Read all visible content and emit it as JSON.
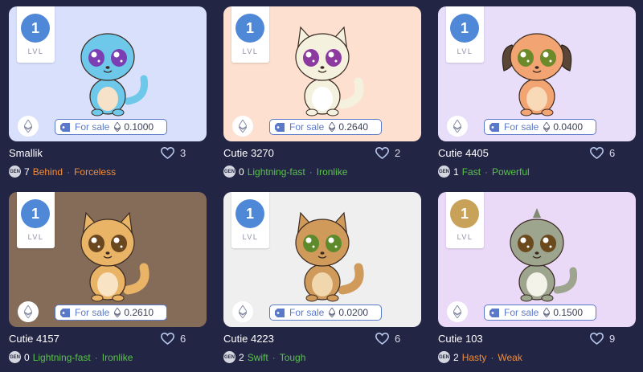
{
  "cards": [
    {
      "name": "Smallik",
      "level": "1",
      "level_label": "LVL",
      "level_color": "#4f88d6",
      "bg": "#d8e0fb",
      "sale_label": "For sale",
      "price": "0.1000",
      "likes": "3",
      "generation": "7",
      "gen_icon": "GEN",
      "trait1": "Behind",
      "trait1_color": "#ef8d3a",
      "trait2": "Forceless",
      "trait2_color": "#ef8d3a",
      "body_color": "#6ec8ea",
      "belly_color": "#f5e2c8",
      "eye_color": "#7b3fb3",
      "species": "lizard"
    },
    {
      "name": "Cutie 3270",
      "level": "1",
      "level_label": "LVL",
      "level_color": "#4f88d6",
      "bg": "#fde0cf",
      "sale_label": "For sale",
      "price": "0.2640",
      "likes": "2",
      "generation": "0",
      "gen_icon": "GEN",
      "trait1": "Lightning-fast",
      "trait1_color": "#59c24a",
      "trait2": "Ironlike",
      "trait2_color": "#59c24a",
      "body_color": "#f4f1de",
      "belly_color": "#ffffff",
      "eye_color": "#8c3aa0",
      "species": "cat"
    },
    {
      "name": "Cutie 4405",
      "level": "1",
      "level_label": "LVL",
      "level_color": "#4f88d6",
      "bg": "#e8def9",
      "sale_label": "For sale",
      "price": "0.0400",
      "likes": "6",
      "generation": "1",
      "gen_icon": "GEN",
      "trait1": "Fast",
      "trait1_color": "#59c24a",
      "trait2": "Powerful",
      "trait2_color": "#59c24a",
      "body_color": "#f2a472",
      "belly_color": "#f8d9b8",
      "eye_color": "#6c8a2a",
      "species": "dog"
    },
    {
      "name": "Cutie 4157",
      "level": "1",
      "level_label": "LVL",
      "level_color": "#4f88d6",
      "bg": "#856c59",
      "sale_label": "For sale",
      "price": "0.2610",
      "likes": "6",
      "generation": "0",
      "gen_icon": "GEN",
      "trait1": "Lightning-fast",
      "trait1_color": "#59c24a",
      "trait2": "Ironlike",
      "trait2_color": "#59c24a",
      "body_color": "#e9b465",
      "belly_color": "#f8e4c4",
      "eye_color": "#6b4720",
      "species": "lynx"
    },
    {
      "name": "Cutie 4223",
      "level": "1",
      "level_label": "LVL",
      "level_color": "#4f88d6",
      "bg": "#efefef",
      "sale_label": "For sale",
      "price": "0.0200",
      "likes": "6",
      "generation": "2",
      "gen_icon": "GEN",
      "trait1": "Swift",
      "trait1_color": "#59c24a",
      "trait2": "Tough",
      "trait2_color": "#59c24a",
      "body_color": "#cf9a5a",
      "belly_color": "#f0d7ae",
      "eye_color": "#5d8a2a",
      "species": "fox"
    },
    {
      "name": "Cutie 103",
      "level": "1",
      "level_label": "LVL",
      "level_color": "#c9a25a",
      "bg": "#ead9f7",
      "sale_label": "For sale",
      "price": "0.1500",
      "likes": "9",
      "generation": "2",
      "gen_icon": "GEN",
      "trait1": "Hasty",
      "trait1_color": "#ef8d3a",
      "trait2": "Weak",
      "trait2_color": "#ef8d3a",
      "body_color": "#9da58e",
      "belly_color": "#f3f3ea",
      "eye_color": "#6b4a1e",
      "species": "dino"
    }
  ]
}
